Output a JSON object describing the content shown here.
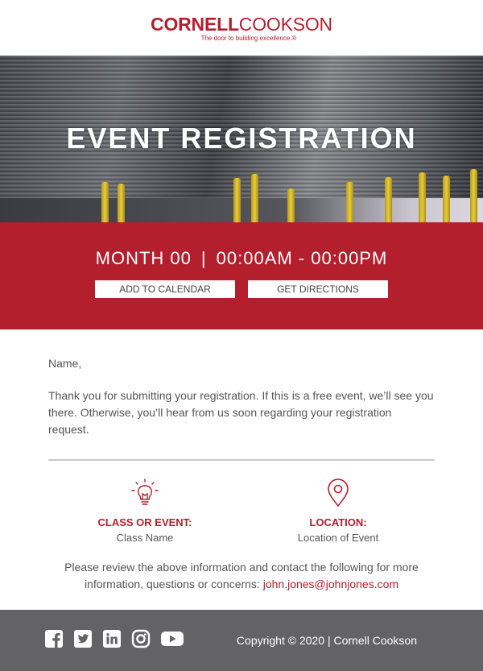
{
  "brand": {
    "logo_bold": "CORNELL",
    "logo_light": "COOKSON",
    "tagline": "The door to building excellence.®",
    "accent_color": "#b31f2d"
  },
  "hero": {
    "title": "EVENT REGISTRATION"
  },
  "event": {
    "date": "MONTH 00",
    "separator": "|",
    "time": "00:00AM - 00:00PM",
    "add_to_calendar": "ADD TO CALENDAR",
    "get_directions": "GET DIRECTIONS"
  },
  "message": {
    "greeting": "Name,",
    "body": "Thank you for submitting your registration. If this is a free event, we’ll see you there. Otherwise, you’ll hear from us soon regarding your registration request."
  },
  "details": {
    "class_label": "CLASS OR EVENT:",
    "class_value": "Class Name",
    "class_icon": "lightbulb-icon",
    "location_label": "LOCATION:",
    "location_value": "Location of Event",
    "location_icon": "map-pin-icon"
  },
  "contact": {
    "text": "Please review the above information and contact the following for more information, questions or concerns: ",
    "email": "john.jones@johnjones.com"
  },
  "footer": {
    "social_icons": [
      "facebook-icon",
      "twitter-icon",
      "linkedin-icon",
      "instagram-icon",
      "youtube-icon"
    ],
    "copyright": "Copyright © 2020 | Cornell Cookson",
    "background": "#636366"
  }
}
